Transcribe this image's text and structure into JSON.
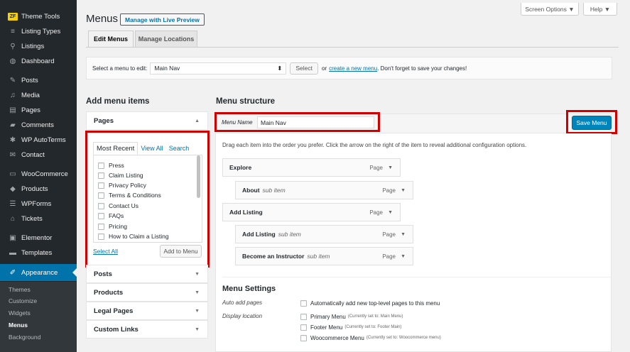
{
  "sidebar": {
    "items": [
      {
        "label": "Theme Tools",
        "icon": "theme-tools-logo"
      },
      {
        "label": "Listing Types",
        "icon": "list-icon"
      },
      {
        "label": "Listings",
        "icon": "location-pin-icon"
      },
      {
        "label": "Dashboard",
        "icon": "palette-icon"
      },
      {
        "label": "Posts",
        "icon": "pin-icon"
      },
      {
        "label": "Media",
        "icon": "media-icon"
      },
      {
        "label": "Pages",
        "icon": "page-icon"
      },
      {
        "label": "Comments",
        "icon": "comment-icon"
      },
      {
        "label": "WP AutoTerms",
        "icon": "autoterms-icon"
      },
      {
        "label": "Contact",
        "icon": "mail-icon"
      },
      {
        "label": "WooCommerce",
        "icon": "woo-icon"
      },
      {
        "label": "Products",
        "icon": "archive-icon"
      },
      {
        "label": "WPForms",
        "icon": "forms-icon"
      },
      {
        "label": "Tickets",
        "icon": "ticket-icon"
      },
      {
        "label": "Elementor",
        "icon": "elementor-icon"
      },
      {
        "label": "Templates",
        "icon": "folder-icon"
      },
      {
        "label": "Appearance",
        "icon": "brush-icon"
      }
    ],
    "submenu": [
      "Themes",
      "Customize",
      "Widgets",
      "Menus",
      "Background"
    ]
  },
  "header": {
    "screen_options": "Screen Options ▼",
    "help": "Help ▼",
    "title": "Menus",
    "live_preview": "Manage with Live Preview",
    "tabs": [
      "Edit Menus",
      "Manage Locations"
    ]
  },
  "select_bar": {
    "label": "Select a menu to edit:",
    "selected": "Main Nav",
    "button": "Select",
    "or_text": "or",
    "create_link": "create a new menu",
    "tail": ". Don't forget to save your changes!"
  },
  "add_items": {
    "title": "Add menu items",
    "pages_label": "Pages",
    "tabs": [
      "Most Recent",
      "View All",
      "Search"
    ],
    "pages": [
      "Press",
      "Claim Listing",
      "Privacy Policy",
      "Terms & Conditions",
      "Contact Us",
      "FAQs",
      "Pricing",
      "How to Claim a Listing"
    ],
    "select_all": "Select All",
    "add_button": "Add to Menu",
    "other_sections": [
      "Posts",
      "Products",
      "Legal Pages",
      "Custom Links"
    ]
  },
  "structure": {
    "title": "Menu structure",
    "name_label": "Menu Name",
    "name_value": "Main Nav",
    "save_button": "Save Menu",
    "instructions": "Drag each item into the order you prefer. Click the arrow on the right of the item to reveal additional configuration options.",
    "items": [
      {
        "label": "Explore",
        "sub": "",
        "type": "Page"
      },
      {
        "label": "About",
        "sub": "sub item",
        "type": "Page"
      },
      {
        "label": "Add Listing",
        "sub": "",
        "type": "Page"
      },
      {
        "label": "Add Listing",
        "sub": "sub item",
        "type": "Page"
      },
      {
        "label": "Become an Instructor",
        "sub": "sub item",
        "type": "Page"
      }
    ]
  },
  "settings": {
    "title": "Menu Settings",
    "auto_add_label": "Auto add pages",
    "auto_add_text": "Automatically add new top-level pages to this menu",
    "display_label": "Display location",
    "locations": [
      {
        "name": "Primary Menu",
        "note": "(Currently set to: Main Menu)"
      },
      {
        "name": "Footer Menu",
        "note": "(Currently set to: Footer Main)"
      },
      {
        "name": "Woocommerce Menu",
        "note": "(Currently set to: Woocommerce menu)"
      }
    ]
  },
  "colors": {
    "accent": "#0073aa",
    "highlight": "#d00000",
    "sidebar": "#23282d",
    "primary_button": "#0085ba"
  }
}
